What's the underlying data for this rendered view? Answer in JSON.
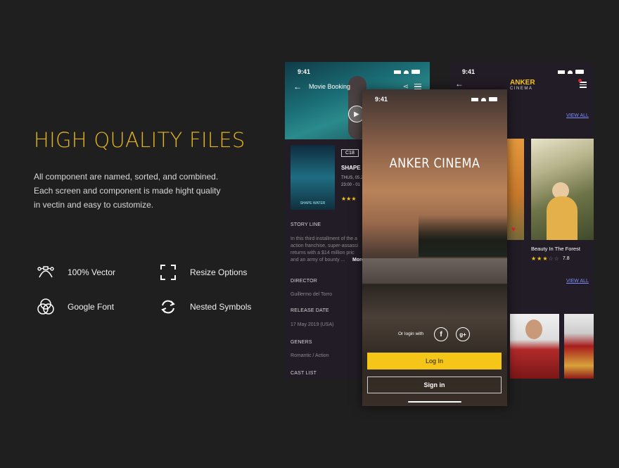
{
  "promo": {
    "title": "HIGH QUALITY FILES",
    "description_lines": [
      "All component are named, sorted, and combined.",
      "Each screen and component is made hight quality",
      "in vectin and easy to customize."
    ],
    "features": [
      {
        "icon": "bezier-vector-icon",
        "label": "100% Vector"
      },
      {
        "icon": "resize-frame-icon",
        "label": "Resize Options"
      },
      {
        "icon": "venn-circles-icon",
        "label": "Google Font"
      },
      {
        "icon": "refresh-arrows-icon",
        "label": "Nested Symbols"
      }
    ]
  },
  "phone_booking": {
    "time": "9:41",
    "header_title": "Movie Booking",
    "rating_badge": "C18",
    "movie_title": "SHAPE O",
    "date_line": "THUS, 05.2",
    "time_line": "23:00 - 01",
    "poster_caption": "SHAPE WATER",
    "sections": {
      "story_label": "STORY LINE",
      "story_text": [
        "In this third installment of the a",
        "action franchise, super-assassi",
        "returns with a $14 million pric",
        "and an army of bounty ..."
      ],
      "more_label": "More",
      "director_label": "DIRECTOR",
      "director_value": "Guillermo del Torro",
      "release_label": "RELEASE DATE",
      "release_value": "17 May 2019 (USA)",
      "genres_label": "GENERS",
      "genres_value": "Romantic / Action",
      "cast_label": "CAST LIST"
    },
    "rating_stars": 3
  },
  "phone_login": {
    "time": "9:41",
    "brand_title": "ANKER CINEMA",
    "or_login_with": "Or login with",
    "facebook_glyph": "f",
    "google_glyph": "g+",
    "login_button": "Log In",
    "signin_button": "Sign in"
  },
  "phone_home": {
    "time": "9:41",
    "brand_line1": "ANKER",
    "brand_line2": "CINEMA",
    "view_all_1": "VIEW ALL",
    "view_all_2": "VIEW ALL",
    "card_title": "Beauty In The Forest",
    "card_rating": "7.8",
    "card_stars": 3
  },
  "colors": {
    "accent": "#f5c518",
    "heading": "#e4b41f",
    "background": "#1f1f1f",
    "phone_bg": "#211b24",
    "link": "#7e8cff",
    "heart": "#e0242b"
  }
}
